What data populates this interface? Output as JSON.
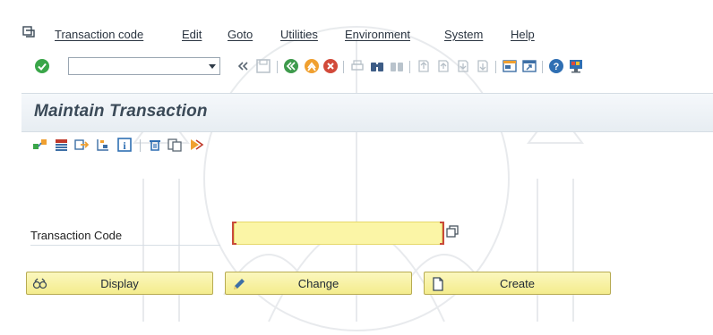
{
  "menu": {
    "items": [
      "Transaction code",
      "Edit",
      "Goto",
      "Utilities",
      "Environment",
      "System",
      "Help"
    ]
  },
  "toolbar": {
    "command_value": "",
    "icons": [
      "enter-icon",
      "command-field-dropdown-icon",
      "collapse-icon",
      "save-icon",
      "back-icon",
      "exit-icon",
      "cancel-icon",
      "print-icon",
      "find-icon",
      "find-next-icon",
      "first-page-icon",
      "previous-page-icon",
      "next-page-icon",
      "last-page-icon",
      "create-session-icon",
      "shortcut-icon",
      "help-icon",
      "customize-layout-icon"
    ]
  },
  "page": {
    "title": "Maintain Transaction"
  },
  "app_toolbar": {
    "icons": [
      "where-used-icon",
      "other-object-icon",
      "transport-icon",
      "package-icon",
      "info-icon",
      "delete-icon",
      "copy-icon",
      "test-icon"
    ]
  },
  "form": {
    "transaction_code_label": "Transaction Code",
    "transaction_code_value": ""
  },
  "buttons": {
    "display": "Display",
    "change": "Change",
    "create": "Create"
  },
  "colors": {
    "required_field_bg": "#fbf5a6",
    "button_bg": "#f4ec8d",
    "required_marker": "#c94a3a",
    "title_text": "#3b4a58"
  }
}
